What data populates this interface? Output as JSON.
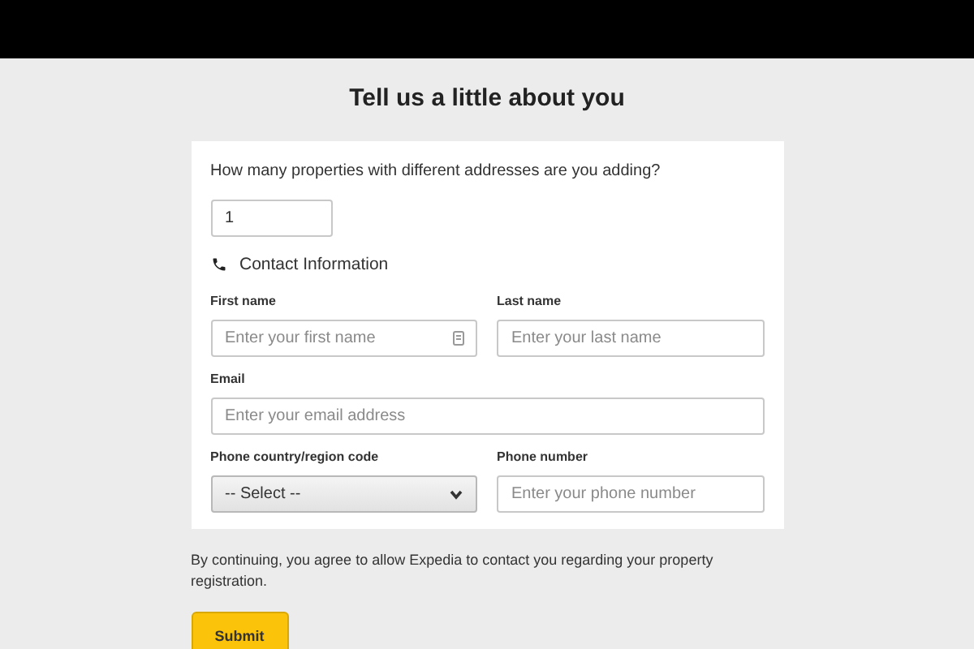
{
  "title": "Tell us a little about you",
  "question": {
    "label": "How many properties with different addresses are you adding?",
    "value": "1"
  },
  "section": {
    "label": "Contact Information"
  },
  "fields": [
    {
      "kind": "text",
      "label": "First name",
      "placeholder": "Enter your first name",
      "half": true,
      "autofill": true
    },
    {
      "kind": "text",
      "label": "Last name",
      "placeholder": "Enter your last name",
      "half": true,
      "autofill": false
    },
    {
      "kind": "text",
      "label": "Email",
      "placeholder": "Enter your email address",
      "half": false,
      "autofill": false
    },
    {
      "kind": "select",
      "label": "Phone country/region code",
      "value": "-- Select --",
      "half": true
    },
    {
      "kind": "text",
      "label": "Phone number",
      "placeholder": "Enter your phone number",
      "half": true,
      "autofill": false
    }
  ],
  "consent": "By continuing, you agree to allow Expedia to contact you regarding your property registration.",
  "submit": "Submit"
}
